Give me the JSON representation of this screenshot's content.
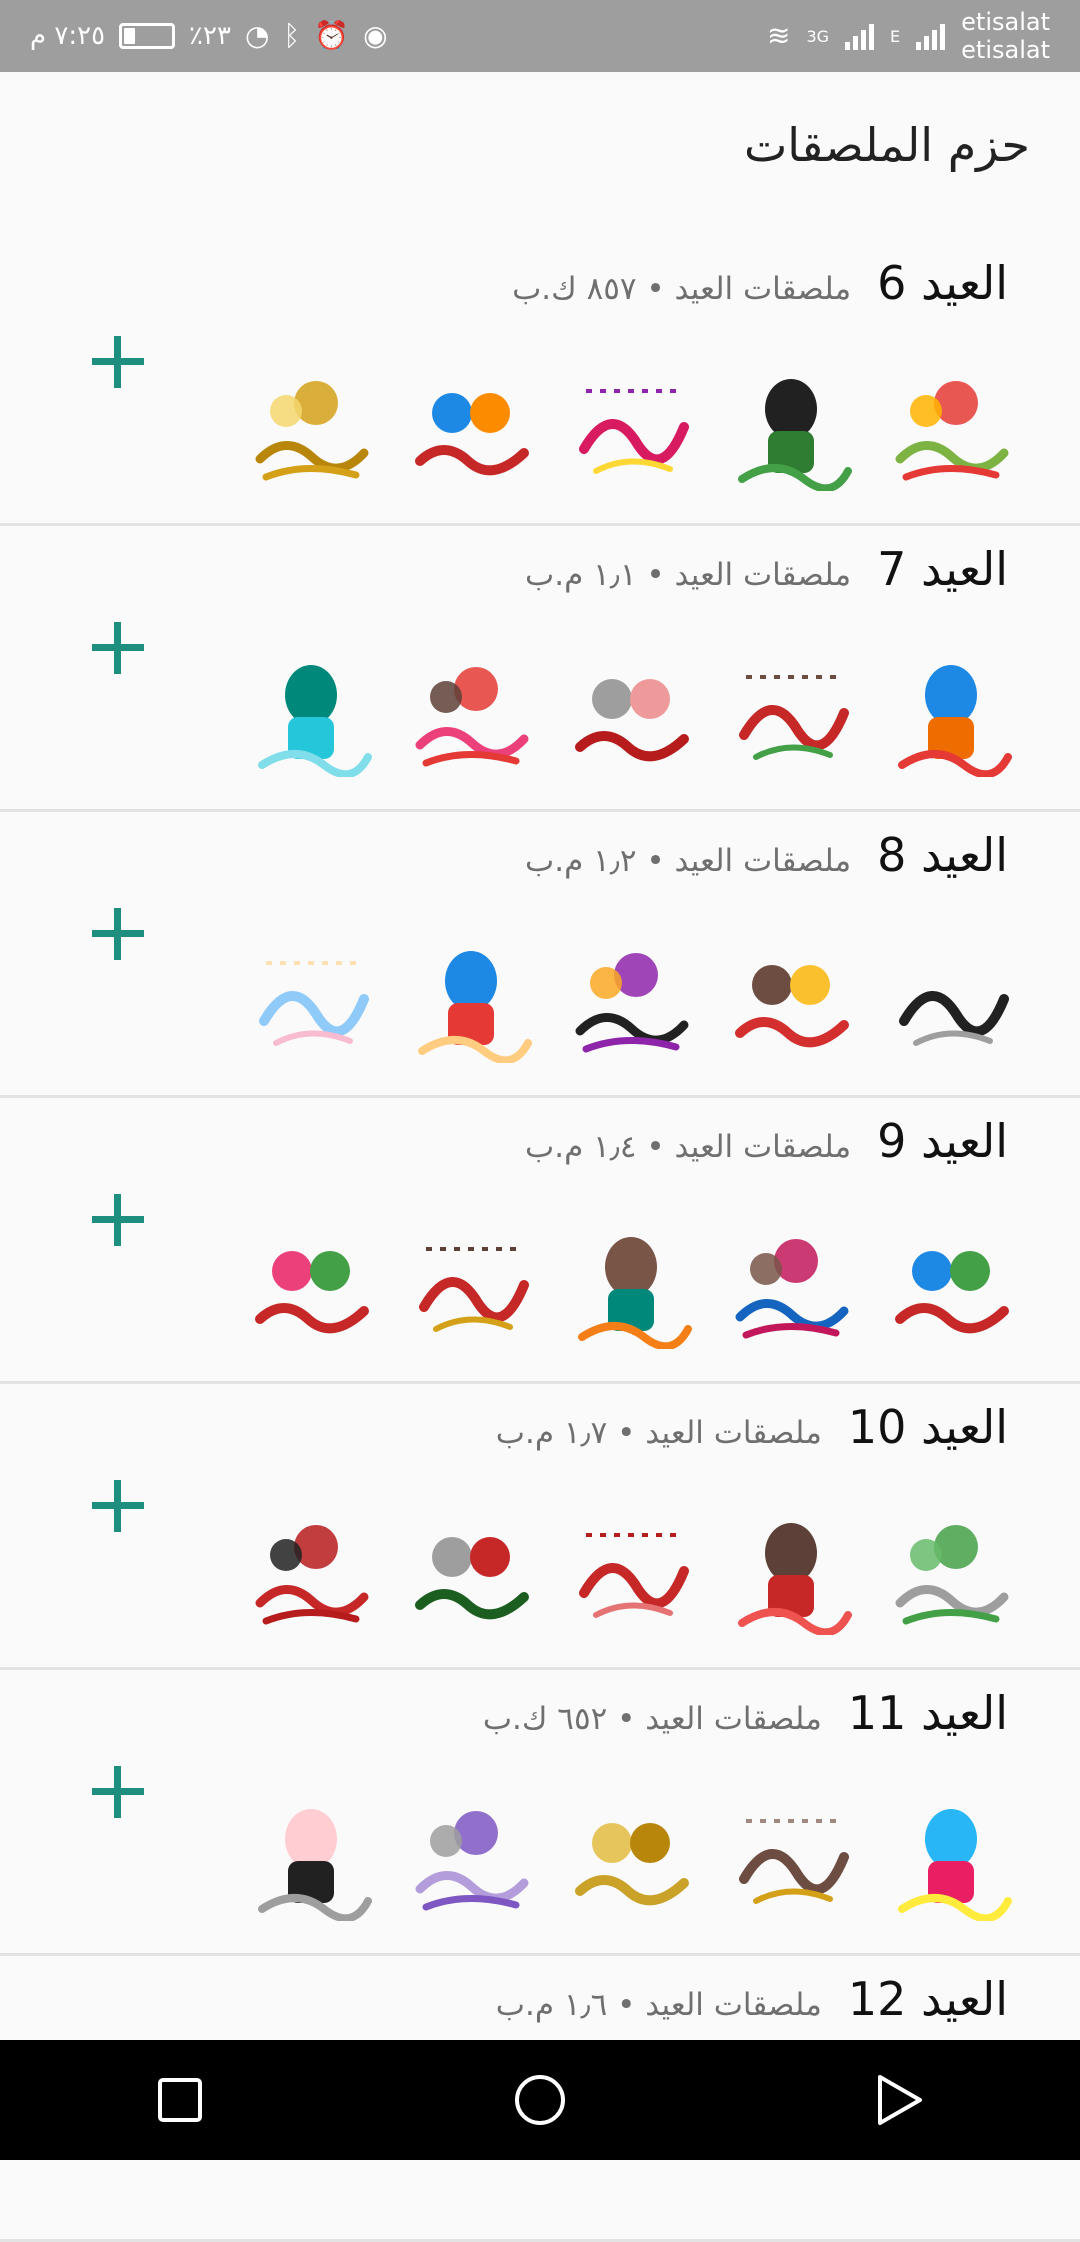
{
  "statusbar": {
    "time": "٧:٢٥ م",
    "battery": "٪٢٣",
    "battery_level": 0.23,
    "carrier_1": "etisalat",
    "carrier_2": "etisalat",
    "network_1": "3G",
    "network_2": "E"
  },
  "page": {
    "title": "حزم الملصقات"
  },
  "packs": [
    {
      "name": "العيد 6",
      "subtitle": "ملصقات العيد • ٨٥٧ ك.ب",
      "stickers": [
        {
          "icon": "sticker-kids-balloons",
          "colors": [
            "#e53935",
            "#7cb342",
            "#ffb300"
          ]
        },
        {
          "icon": "sticker-woman-niqab",
          "colors": [
            "#2e7d32",
            "#212121",
            "#43a047"
          ]
        },
        {
          "icon": "sticker-calligraphy",
          "colors": [
            "#d81b60",
            "#fdd835",
            "#8e24aa"
          ]
        },
        {
          "icon": "sticker-kids-group",
          "colors": [
            "#c62828",
            "#fb8c00",
            "#1e88e5"
          ]
        },
        {
          "icon": "sticker-gold-lanterns",
          "colors": [
            "#d4a017",
            "#b8860b",
            "#f5d76e"
          ]
        }
      ]
    },
    {
      "name": "العيد 7",
      "subtitle": "ملصقات العيد • ١٫١ م.ب",
      "stickers": [
        {
          "icon": "sticker-kids-faces",
          "colors": [
            "#ef6c00",
            "#1e88e5",
            "#e53935"
          ]
        },
        {
          "icon": "sticker-boys-balloons",
          "colors": [
            "#c62828",
            "#43a047",
            "#6d4c41"
          ]
        },
        {
          "icon": "sticker-hanging-lanterns",
          "colors": [
            "#b71c1c",
            "#ef9a9a",
            "#9e9e9e"
          ]
        },
        {
          "icon": "sticker-girl-balloons",
          "colors": [
            "#e53935",
            "#ec407a",
            "#5d4037"
          ]
        },
        {
          "icon": "sticker-girl-hijab",
          "colors": [
            "#26c6da",
            "#00897b",
            "#80deea"
          ]
        }
      ]
    },
    {
      "name": "العيد 8",
      "subtitle": "ملصقات العيد • ١٫٢ م.ب",
      "stickers": [
        {
          "icon": "sticker-sheep-calligraphy",
          "colors": [
            "#212121",
            "#9e9e9e",
            "#fafafa"
          ]
        },
        {
          "icon": "sticker-kids-table",
          "colors": [
            "#d32f2f",
            "#fbc02d",
            "#6d4c41"
          ]
        },
        {
          "icon": "sticker-woman-niqab",
          "colors": [
            "#8e24aa",
            "#212121",
            "#f9a825"
          ]
        },
        {
          "icon": "sticker-kids-hugging",
          "colors": [
            "#e53935",
            "#1e88e5",
            "#ffcc80"
          ]
        },
        {
          "icon": "sticker-baby",
          "colors": [
            "#90caf9",
            "#f8bbd0",
            "#ffe0b2"
          ]
        }
      ]
    },
    {
      "name": "العيد 9",
      "subtitle": "ملصقات العيد • ١٫٤ م.ب",
      "stickers": [
        {
          "icon": "sticker-balloons-text",
          "colors": [
            "#c62828",
            "#43a047",
            "#1e88e5"
          ]
        },
        {
          "icon": "sticker-family",
          "colors": [
            "#c2185b",
            "#1565c0",
            "#795548"
          ]
        },
        {
          "icon": "sticker-couple",
          "colors": [
            "#00897b",
            "#795548",
            "#f57f17"
          ]
        },
        {
          "icon": "sticker-girl-coffee",
          "colors": [
            "#c62828",
            "#d4a017",
            "#5d4037"
          ]
        },
        {
          "icon": "sticker-crowd",
          "colors": [
            "#c62828",
            "#43a047",
            "#ec407a"
          ]
        }
      ]
    },
    {
      "name": "العيد 10",
      "subtitle": "ملصقات العيد • ١٫٧ م.ب",
      "stickers": [
        {
          "icon": "sticker-sheep-grass",
          "colors": [
            "#43a047",
            "#9e9e9e",
            "#66bb6a"
          ]
        },
        {
          "icon": "sticker-girl-text",
          "colors": [
            "#c62828",
            "#5d4037",
            "#ef5350"
          ]
        },
        {
          "icon": "sticker-red-calligraphy",
          "colors": [
            "#c62828",
            "#e57373",
            "#b71c1c"
          ]
        },
        {
          "icon": "sticker-green-gifts",
          "colors": [
            "#1b5e20",
            "#c62828",
            "#9e9e9e"
          ]
        },
        {
          "icon": "sticker-red-mosque",
          "colors": [
            "#b71c1c",
            "#c62828",
            "#212121"
          ]
        }
      ]
    },
    {
      "name": "العيد 11",
      "subtitle": "ملصقات العيد • ٦٥٢ ك.ب",
      "stickers": [
        {
          "icon": "sticker-fireworks",
          "colors": [
            "#e91e63",
            "#29b6f6",
            "#ffeb3b"
          ]
        },
        {
          "icon": "sticker-mosque-gold",
          "colors": [
            "#6d4c41",
            "#d4a017",
            "#a1887f"
          ]
        },
        {
          "icon": "sticker-gold-text",
          "colors": [
            "#c9a227",
            "#b8860b",
            "#e6c65c"
          ]
        },
        {
          "icon": "sticker-flower-frame",
          "colors": [
            "#7e57c2",
            "#b39ddb",
            "#9e9e9e"
          ]
        },
        {
          "icon": "sticker-black-text",
          "colors": [
            "#212121",
            "#ffcdd2",
            "#9e9e9e"
          ]
        }
      ]
    },
    {
      "name": "العيد 12",
      "subtitle": "ملصقات العيد • ١٫٦ م.ب",
      "stickers": []
    }
  ],
  "colors": {
    "accent": "#1e8e7e",
    "statusbar": "#9e9e9e",
    "divider": "#e3e3e3"
  },
  "navbar": {
    "back_icon": "triangle-back-icon",
    "home_icon": "circle-home-icon",
    "recents_icon": "square-recents-icon"
  }
}
